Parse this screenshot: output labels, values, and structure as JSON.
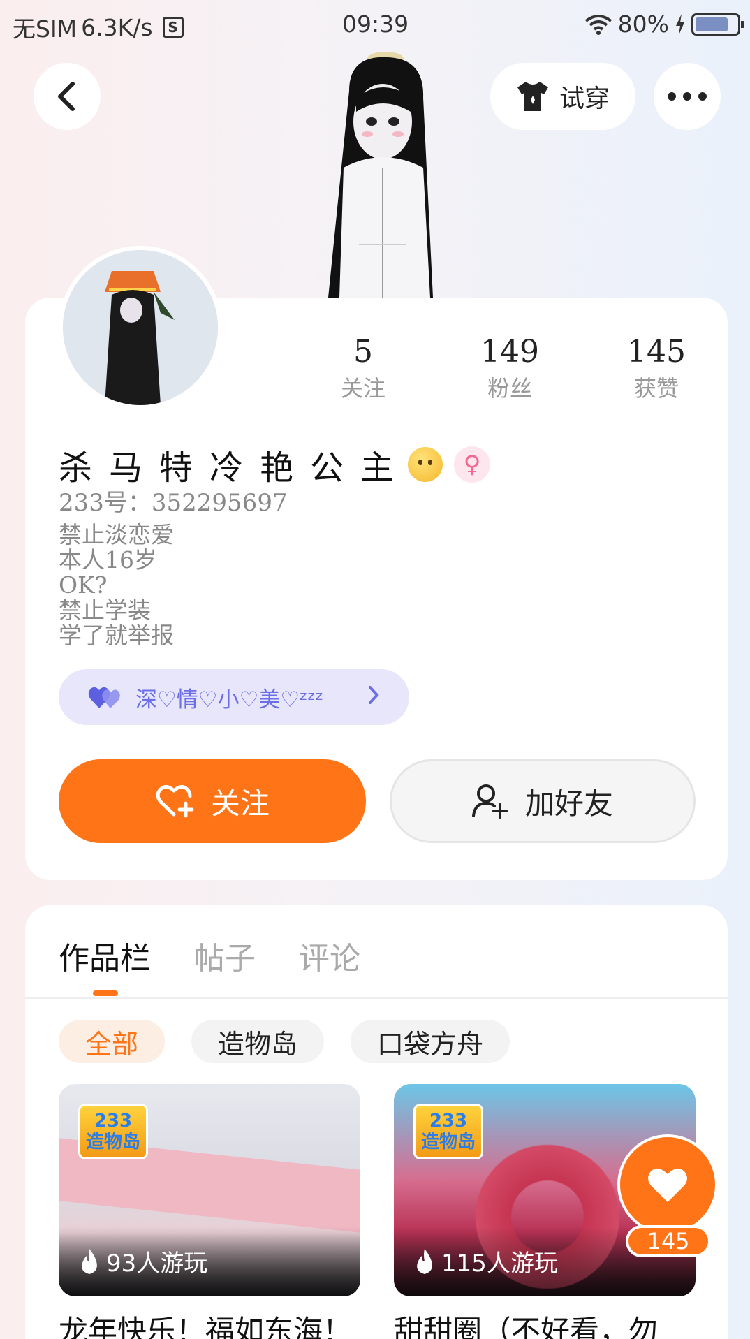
{
  "status_bar": {
    "carrier": "无SIM",
    "speed": "6.3K/s",
    "s_badge": "S",
    "time": "09:39",
    "battery": "80%"
  },
  "header": {
    "tryon_label": "试穿"
  },
  "stats": [
    {
      "num": "5",
      "label": "关注"
    },
    {
      "num": "149",
      "label": "粉丝"
    },
    {
      "num": "145",
      "label": "获赞"
    }
  ],
  "profile": {
    "name": "杀马特冷艳公主",
    "gender_symbol": "♀",
    "uid": "233号：352295697",
    "bio_lines": [
      "禁止淡恋爱",
      "本人16岁",
      "OK?",
      "禁止学装",
      "学了就举报"
    ],
    "tag": "深♡情♡小♡美♡ᶻᶻᶻ"
  },
  "actions": {
    "follow_label": "关注",
    "add_friend_label": "加好友"
  },
  "tabs": [
    "作品栏",
    "帖子",
    "评论"
  ],
  "filters": [
    "全部",
    "造物岛",
    "口袋方舟"
  ],
  "games": [
    {
      "logo_top": "233",
      "logo_bottom": "造物岛",
      "plays": "93人游玩",
      "title": "龙年快乐！福如东海！"
    },
    {
      "logo_top": "233",
      "logo_bottom": "造物岛",
      "plays": "115人游玩",
      "title": "甜甜圈（不好看，勿"
    }
  ],
  "like_fab": {
    "count": "145"
  },
  "colors": {
    "accent": "#ff7416",
    "tag_text": "#6b6ee6",
    "tag_bg": "#e8e6fb"
  }
}
